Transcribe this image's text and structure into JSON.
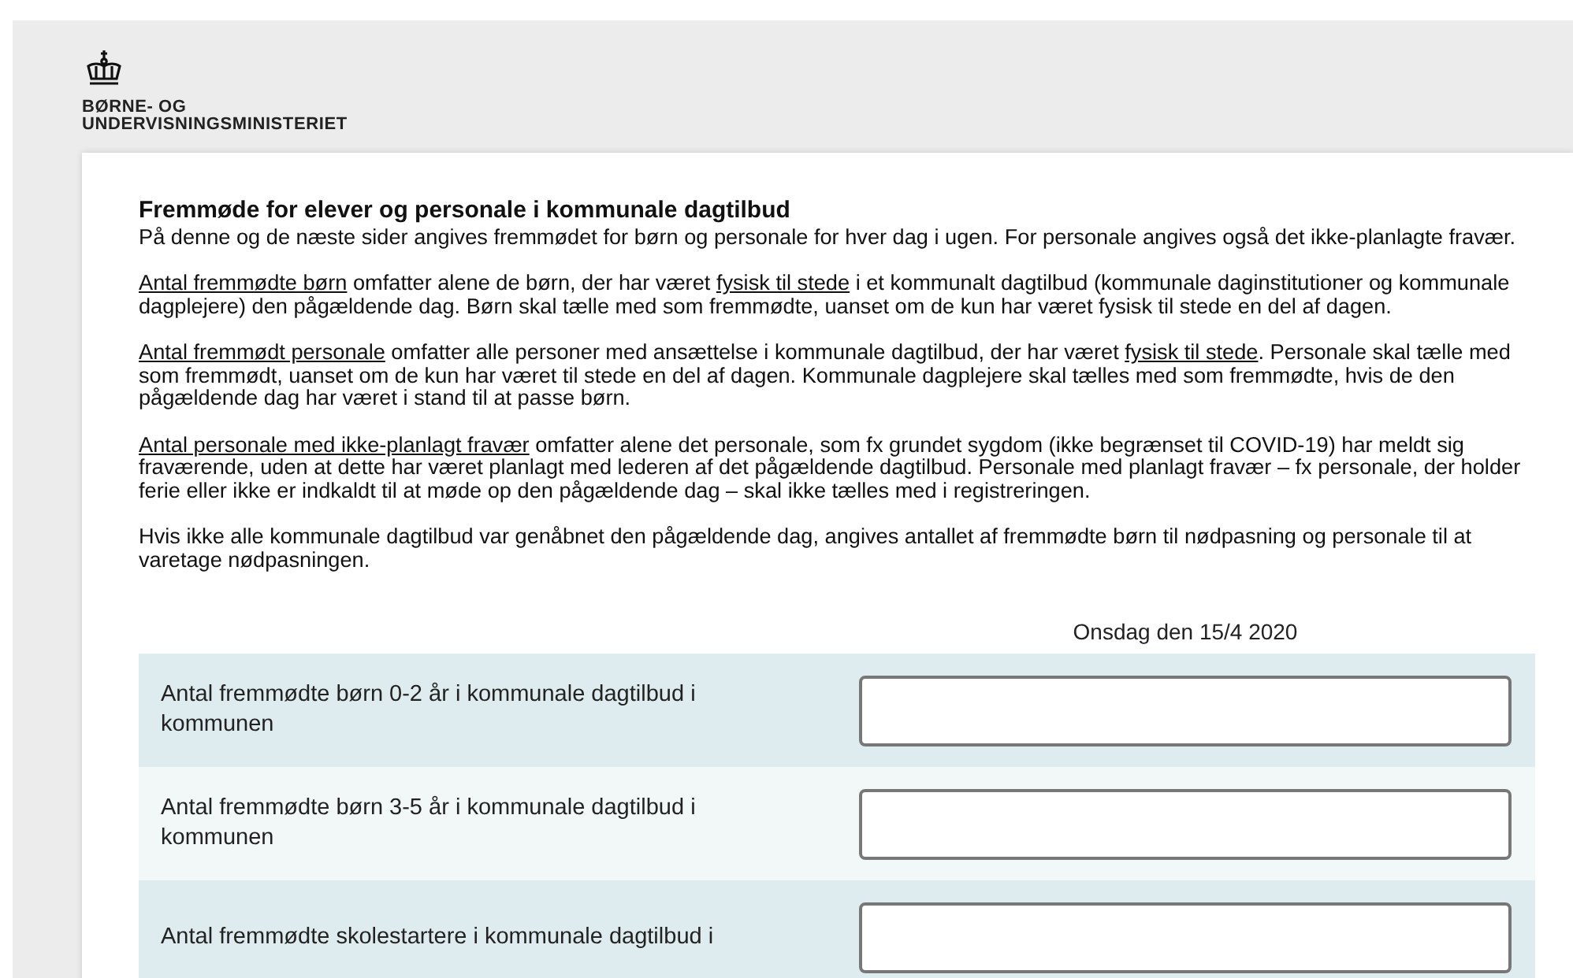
{
  "logo": {
    "line_1": "BØRNE- OG",
    "line_2": "UNDERVISNINGSMINISTERIET"
  },
  "title": "Fremmøde for elever og personale i kommunale dagtilbud",
  "intro": "På denne og de næste sider angives fremmødet for børn og personale for hver dag i ugen. For personale angives også det ikke-planlagte fravær.",
  "paragraphs": [
    [
      {
        "text": "Antal fremmødte børn",
        "underlined": true
      },
      {
        "text": " omfatter alene de børn, der har været ",
        "underlined": false
      },
      {
        "text": "fysisk til stede",
        "underlined": true
      },
      {
        "text": " i et kommunalt dagtilbud (kommunale daginstitutioner og kommunale dagplejere) den pågældende dag. Børn skal tælle med som fremmødte, uanset om de kun har været fysisk til stede en del af dagen.",
        "underlined": false
      }
    ],
    [
      {
        "text": "Antal fremmødt personale",
        "underlined": true
      },
      {
        "text": " omfatter alle personer med ansættelse i kommunale dagtilbud, der har været ",
        "underlined": false
      },
      {
        "text": "fysisk til stede",
        "underlined": true
      },
      {
        "text": ". Personale skal tælle med som fremmødt, uanset om de kun har været til stede en del af dagen. Kommunale dagplejere skal tælles med som fremmødte, hvis de den pågældende dag har været i stand til at passe børn.",
        "underlined": false
      }
    ],
    [
      {
        "text": "Antal personale med ikke-planlagt fravær",
        "underlined": true
      },
      {
        "text": " omfatter alene det personale, som fx grundet sygdom (ikke begrænset til COVID-19) har meldt sig fraværende, uden at dette har været planlagt med lederen af det pågældende dagtilbud. Personale med planlagt fravær – fx personale, der holder ferie eller ikke er indkaldt til at møde op den pågældende dag – skal ikke tælles med i registreringen.",
        "underlined": false
      }
    ],
    [
      {
        "text": "Hvis ikke alle kommunale dagtilbud var genåbnet den pågældende dag, angives antallet af fremmødte børn til nødpasning og personale til at varetage nødpasningen.",
        "underlined": false
      }
    ]
  ],
  "column_header": "Onsdag den 15/4 2020",
  "rows": [
    {
      "label": "Antal fremmødte børn 0-2 år i kommunale dagtilbud i kommunen"
    },
    {
      "label": "Antal fremmødte børn 3-5 år i kommunale dagtilbud i kommunen"
    },
    {
      "label": "Antal fremmødte skolestartere i kommunale dagtilbud i"
    }
  ]
}
